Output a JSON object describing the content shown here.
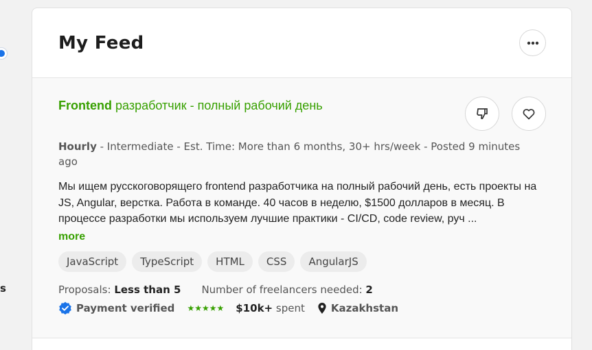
{
  "feed": {
    "title": "My Feed",
    "menu_icon": "more-horizontal-icon"
  },
  "job": {
    "title_bold": "Frontend",
    "title_rest": " разработчик - полный рабочий день",
    "meta_bold": "Hourly",
    "meta_rest": " - Intermediate - Est. Time: More than 6 months, 30+ hrs/week - Posted 9 minutes ago",
    "description": "Мы ищем русскоговорящего frontend разработчика на полный рабочий день, есть проекты на JS, Angular, верстка. Работа в команде. 40 часов в неделю, $1500 долларов в месяц. В процессе разработки мы используем лучшие практики - CI/CD, code review, руч ...",
    "more_label": "more",
    "tags": [
      "JavaScript",
      "TypeScript",
      "HTML",
      "CSS",
      "AngularJS"
    ],
    "proposals_label": "Proposals: ",
    "proposals_value": "Less than 5",
    "freelancers_label": "Number of freelancers needed: ",
    "freelancers_value": "2",
    "payment_label": "Payment verified",
    "rating_stars": 5,
    "spent_value": "$10k+",
    "spent_label": " spent",
    "location": "Kazakhstan",
    "colors": {
      "accent": "#37a000",
      "verified": "#1a73e8"
    }
  },
  "left_edge_letter": "s"
}
